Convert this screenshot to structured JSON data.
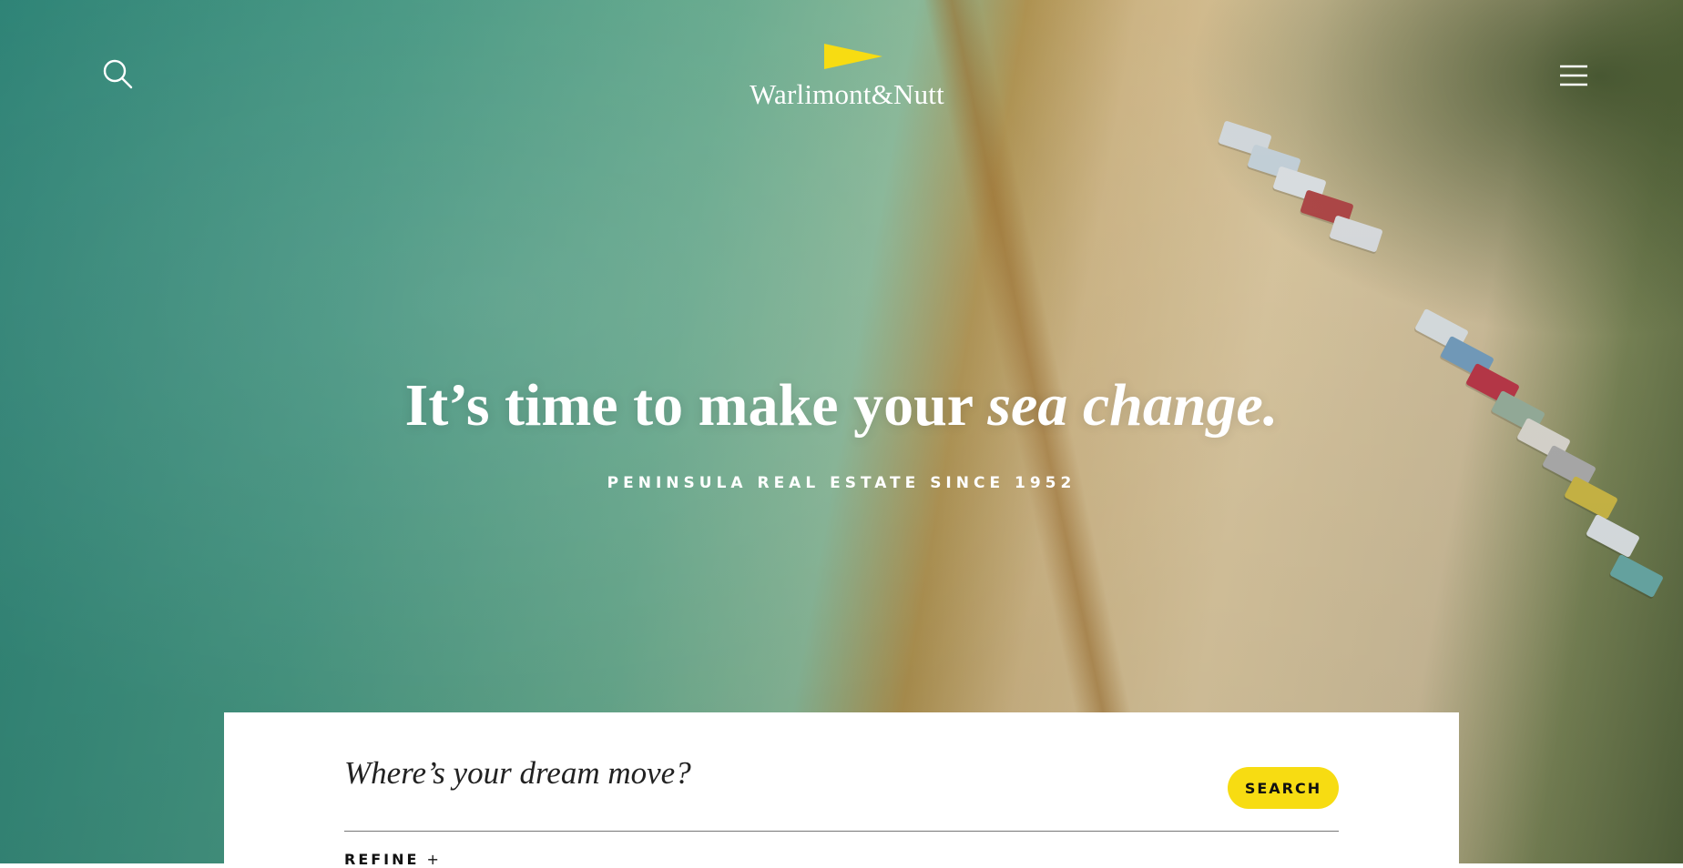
{
  "brand": {
    "name": "Warlimont&Nutt",
    "accent_color": "#F7DC12"
  },
  "header": {
    "search_icon": "search-icon",
    "menu_icon": "hamburger-menu-icon"
  },
  "hero": {
    "headline_regular": "It’s time to make your ",
    "headline_italic": "sea change.",
    "subheadline": "PENINSULA REAL ESTATE SINCE 1952"
  },
  "search": {
    "placeholder": "Where’s your dream move?",
    "button_label": "SEARCH",
    "refine_label": "REFINE",
    "refine_icon": "+"
  }
}
